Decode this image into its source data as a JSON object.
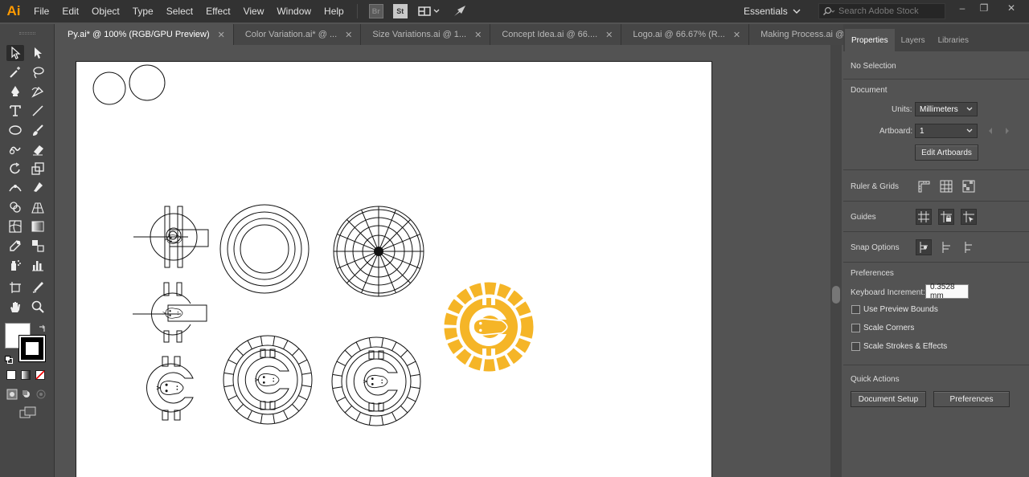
{
  "app": {
    "logo": "Ai"
  },
  "menu": [
    "File",
    "Edit",
    "Object",
    "Type",
    "Select",
    "Effect",
    "View",
    "Window",
    "Help"
  ],
  "menubar_icons": {
    "bridge": "Br",
    "stock": "St",
    "arrange": "arrange-documents-icon",
    "gpu": "gpu-performance-icon"
  },
  "workspace": "Essentials",
  "search": {
    "placeholder": "Search Adobe Stock"
  },
  "window_controls": {
    "minimize": "–",
    "restore": "❐",
    "close": "✕"
  },
  "tabs": [
    {
      "label": "Py.ai* @ 100% (RGB/GPU Preview)",
      "active": true
    },
    {
      "label": "Color Variation.ai* @ ...",
      "active": false
    },
    {
      "label": "Size Variations.ai @ 1...",
      "active": false
    },
    {
      "label": "Concept Idea.ai @ 66....",
      "active": false
    },
    {
      "label": "Logo.ai @ 66.67% (R...",
      "active": false
    },
    {
      "label": "Making Process.ai @ ...",
      "active": false
    }
  ],
  "tab_close": "✕",
  "tools": [
    "selection-tool",
    "direct-selection-tool",
    "magic-wand-tool",
    "lasso-tool",
    "pen-tool",
    "curvature-tool",
    "type-tool",
    "line-segment-tool",
    "ellipse-tool",
    "paintbrush-tool",
    "shaper-tool",
    "eraser-tool",
    "rotate-tool",
    "scale-tool",
    "width-tool",
    "puppet-warp-tool",
    "shape-builder-tool",
    "perspective-grid-tool",
    "mesh-tool",
    "gradient-tool",
    "eyedropper-tool",
    "blend-tool",
    "symbol-sprayer-tool",
    "column-graph-tool",
    "artboard-tool",
    "slice-tool",
    "hand-tool",
    "zoom-tool"
  ],
  "panel": {
    "tabs": [
      {
        "label": "Properties",
        "active": true
      },
      {
        "label": "Layers",
        "active": false
      },
      {
        "label": "Libraries",
        "active": false
      }
    ],
    "selection": "No Selection",
    "document": {
      "heading": "Document",
      "units_label": "Units:",
      "units_value": "Millimeters",
      "artboard_label": "Artboard:",
      "artboard_value": "1",
      "edit_artboards": "Edit Artboards"
    },
    "ruler_grids": "Ruler & Grids",
    "guides": "Guides",
    "snap_options": "Snap Options",
    "preferences": {
      "heading": "Preferences",
      "keyboard_increment_label": "Keyboard Increment:",
      "keyboard_increment_value": "0.3528 mm",
      "checkboxes": [
        {
          "label": "Use Preview Bounds",
          "checked": false
        },
        {
          "label": "Scale Corners",
          "checked": false
        },
        {
          "label": "Scale Strokes & Effects",
          "checked": false
        }
      ]
    },
    "quick_actions": {
      "heading": "Quick Actions",
      "document_setup": "Document Setup",
      "preferences_button": "Preferences"
    }
  },
  "colors": {
    "accent_logo": "#f5b527",
    "ai_orange": "#ff9a00"
  }
}
